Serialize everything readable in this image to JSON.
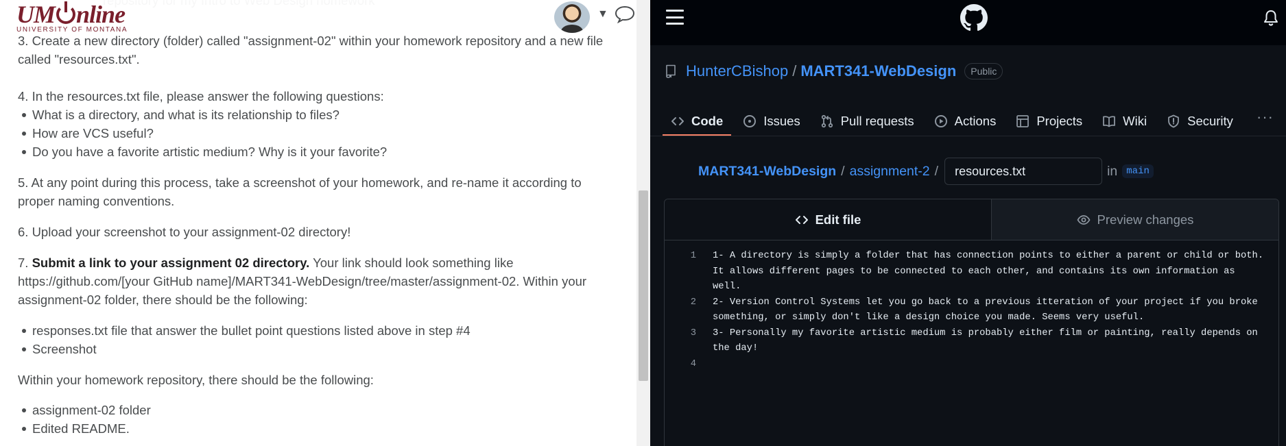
{
  "canvas": {
    "left": {
      "logo": {
        "main_left": "UM",
        "main_right": "nline",
        "subtitle": "UNIVERSITY OF MONTANA"
      },
      "header": {
        "caret_glyph": "▼",
        "avatar_icon": "user-avatar",
        "chat_icon": "chat-bubble-icon"
      },
      "clipped_top_line": "repository for my Intro to Web Design homework\"",
      "step3": "3. Create a new directory (folder) called \"assignment-02\" within your homework repository and a new file called \"resources.txt\".",
      "step4": {
        "intro": "4. In the resources.txt file, please answer the following questions:",
        "items": [
          "What is a directory, and what is its relationship to files?",
          "How are VCS useful?",
          "Do you have a favorite artistic medium? Why is it your favorite?"
        ]
      },
      "step5": "5. At any point during this process, take a screenshot of your homework, and re-name it according to proper naming conventions.",
      "step6": "6. Upload your screenshot to your assignment-02 directory!",
      "step7": {
        "number": "7.",
        "bold": "Submit a link to your assignment 02 directory.",
        "rest": "Your link should look something like https://github.com/[your GitHub name]/MART341-WebDesign/tree/master/assignment-02. Within your assignment-02 folder, there should be the following:",
        "items": [
          "responses.txt file that answer the bullet point questions listed above in step #4",
          "Screenshot"
        ]
      },
      "repo_req": {
        "intro": "Within your homework repository, there should be the following:",
        "items": [
          "assignment-02 folder",
          "Edited README."
        ]
      }
    },
    "right": {
      "repo": {
        "owner": "HunterCBishop",
        "separator": "/",
        "name": "MART341-WebDesign",
        "visibility": "Public"
      },
      "tabs": [
        {
          "label": "Code",
          "icon": "code-icon",
          "active": true
        },
        {
          "label": "Issues",
          "icon": "issue-opened-icon",
          "active": false
        },
        {
          "label": "Pull requests",
          "icon": "git-pull-request-icon",
          "active": false
        },
        {
          "label": "Actions",
          "icon": "play-icon",
          "active": false
        },
        {
          "label": "Projects",
          "icon": "table-icon",
          "active": false
        },
        {
          "label": "Wiki",
          "icon": "book-icon",
          "active": false
        },
        {
          "label": "Security",
          "icon": "shield-icon",
          "active": false
        }
      ],
      "more_tabs": "···",
      "path": {
        "root": "MART341-WebDesign",
        "dir": "assignment-2",
        "sep": "/",
        "filename": "resources.txt",
        "in_label": "in",
        "branch": "main"
      },
      "editor": {
        "edit_tab": "Edit file",
        "preview_tab": "Preview changes",
        "lines": [
          {
            "num": "1",
            "text": "1- A directory is simply a folder that has connection points to either a parent or child or both. It allows different pages to be connected to each other, and contains its own information as well."
          },
          {
            "num": "2",
            "text": "2- Version Control Systems let you go back to a previous itteration of your project if you broke something, or simply don't like a design choice you made. Seems very useful."
          },
          {
            "num": "3",
            "text": "3- Personally my favorite artistic medium is probably either film or painting, really depends on the day!"
          },
          {
            "num": "4",
            "text": ""
          }
        ]
      }
    },
    "colors": {
      "um_maroon": "#7a1f2c",
      "gh_bg": "#0d1117",
      "gh_link": "#4493f8",
      "gh_tab_underline": "#f78166"
    }
  }
}
